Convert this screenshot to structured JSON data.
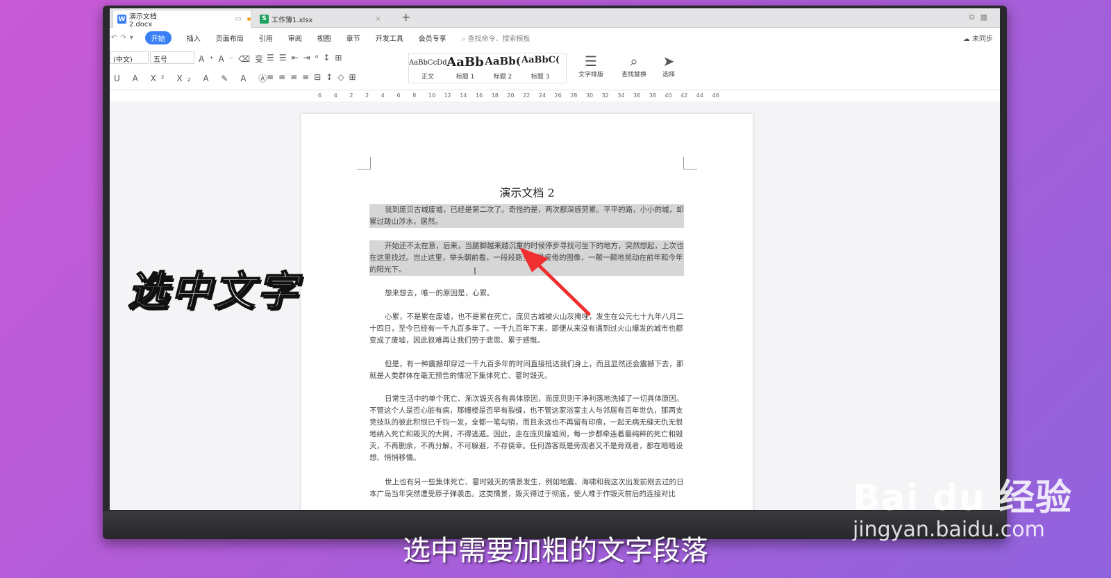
{
  "tabs": [
    {
      "label": "演示文档2.docx",
      "icon": "W",
      "color": "#3a7ff6"
    },
    {
      "label": "工作簿1.xlsx",
      "icon": "S",
      "color": "#1fa260"
    }
  ],
  "menu": {
    "items": [
      "开始",
      "插入",
      "页面布局",
      "引用",
      "审阅",
      "视图",
      "章节",
      "开发工具",
      "会员专享"
    ],
    "search": "查找命令、搜索模板",
    "sync": "未同步"
  },
  "toolbar": {
    "font_name": "(中文)",
    "font_size": "五号",
    "styles": [
      {
        "sample": "AaBbCcDd",
        "label": "正文"
      },
      {
        "sample": "AaBb",
        "label": "标题 1"
      },
      {
        "sample": "AaBb(",
        "label": "标题 2"
      },
      {
        "sample": "AaBbC(",
        "label": "标题 3"
      }
    ],
    "text_layout": "文字排版",
    "find_replace": "查找替换",
    "select": "选择"
  },
  "ruler": [
    "6",
    "4",
    "2",
    "2",
    "4",
    "6",
    "8",
    "10",
    "12",
    "14",
    "16",
    "18",
    "20",
    "22",
    "24",
    "26",
    "28",
    "30",
    "32",
    "34",
    "36",
    "38",
    "40",
    "42",
    "44",
    "46"
  ],
  "document": {
    "title": "演示文档 2",
    "paragraphs": [
      "我到庞贝古城废墟，已经是第二次了。奇怪的是，两次都深感劳累。平平的路，小小的城，却累过跋山涉水，居然。",
      "开始还不太在意，后来，当腿脚越来越沉重的时候停步寻找可坐下的地方，突然想起，上次也在这里找过。岂止这里，举头朝前看，一段段路全是最疲倦的图像，一颠一颠地晃动在前年和今年的阳光下。",
      "想来想去，唯一的原因是，心累。",
      "心累，不是累在废墟，也不是累在死亡。庞贝古城被火山灰掩埋，发生在公元七十九年八月二十四日，至今已经有一千九百多年了。一千九百年下来，即便从来没有遇到过火山爆发的城市也都变成了废墟，因此很难再让我们劳于悲思、累于感慨。",
      "但是，有一种震撼却穿过一千九百多年的时间直接抵达我们身上，而且显然还会震撼下去，那就是人类群体在毫无预告的情况下集体死亡、霎时毁灭。",
      "日常生活中的单个死亡、渐次毁灭各有具体原因，而庞贝则干净利落地洗掉了一切具体原因。不管这个人是否心脏有病，那幢楼是否早有裂缝，也不管这家浴室主人与邻居有百年世仇，那两支竞技队的彼此积恨已千钧一发，全都一笔勾销，而且永远也不再留有印痕，一起无病无缝无仇无恨地纳入死亡和毁灭的大网，不得逃遁。因此，走在庞贝废墟间，每一步都牵连着最纯粹的死亡和毁灭，不再删余，不再分解，不可躲避，不存侥幸。任何游客既是旁观者又不是旁观者，都在暗暗设想、悄悄移情。",
      "世上也有另一些集体死亡、霎时毁灭的情景发生，例如地震、海啸和我这次出发前刚去过的日本广岛当年突然遭受原子弹袭击。这类情景，毁灭得过于彻底，使人难于作毁灭前后的连接对比"
    ]
  },
  "overlay_title": "选中文字",
  "caption": "选中需要加粗的文字段落",
  "watermark": {
    "logo": "Bai du 经验",
    "url": "jingyan.baidu.com"
  }
}
